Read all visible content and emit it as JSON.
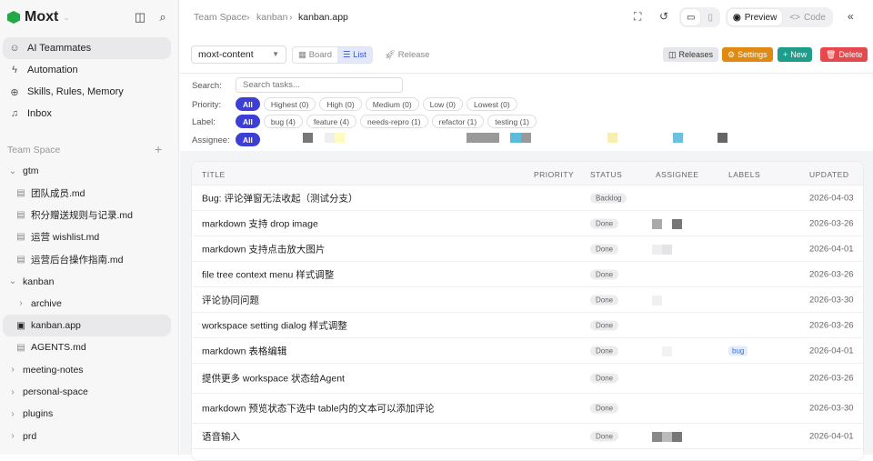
{
  "sidebar": {
    "brand": "Moxt",
    "nav": [
      {
        "label": "AI Teammates",
        "icon": "teammates-icon"
      },
      {
        "label": "Automation",
        "icon": "bolt-icon"
      },
      {
        "label": "Skills, Rules, Memory",
        "icon": "skills-icon"
      },
      {
        "label": "Inbox",
        "icon": "bell-icon"
      }
    ],
    "section": "Team Space",
    "tree": [
      {
        "label": "gtm",
        "type": "folder",
        "open": true,
        "depth": 0
      },
      {
        "label": "团队成员.md",
        "type": "file",
        "depth": 1
      },
      {
        "label": "积分赠送规则与记录.md",
        "type": "file",
        "depth": 1
      },
      {
        "label": "运营 wishlist.md",
        "type": "file",
        "depth": 1
      },
      {
        "label": "运营后台操作指南.md",
        "type": "file",
        "depth": 1
      },
      {
        "label": "kanban",
        "type": "folder",
        "open": true,
        "depth": 0
      },
      {
        "label": "archive",
        "type": "folder",
        "depth": 1
      },
      {
        "label": "kanban.app",
        "type": "app",
        "depth": 1,
        "active": true
      },
      {
        "label": "AGENTS.md",
        "type": "file",
        "depth": 1
      },
      {
        "label": "meeting-notes",
        "type": "folder",
        "depth": 0
      },
      {
        "label": "personal-space",
        "type": "folder",
        "depth": 0
      },
      {
        "label": "plugins",
        "type": "folder",
        "depth": 0
      },
      {
        "label": "prd",
        "type": "folder",
        "depth": 0
      }
    ]
  },
  "header": {
    "breadcrumb": [
      "Team Space",
      "kanban",
      "kanban.app"
    ],
    "preview": "Preview",
    "code": "Code"
  },
  "toolbar": {
    "project": "moxt-content",
    "board": "Board",
    "list": "List",
    "release": "Release",
    "releases": "Releases",
    "settings": "Settings",
    "new": "New",
    "delete": "Delete",
    "colors": {
      "settings": "#e08a12",
      "new": "#1e9e8a",
      "delete": "#e5484d"
    }
  },
  "filters": {
    "search_label": "Search:",
    "search_placeholder": "Search tasks...",
    "priority_label": "Priority:",
    "priority": [
      "All",
      "Highest (0)",
      "High (0)",
      "Medium (0)",
      "Low (0)",
      "Lowest (0)"
    ],
    "label_label": "Label:",
    "labels": [
      "All",
      "bug (4)",
      "feature (4)",
      "needs-repro (1)",
      "refactor (1)",
      "testing (1)"
    ],
    "assignee_label": "Assignee:",
    "assignee_all": "All"
  },
  "table": {
    "columns": [
      "TITLE",
      "PRIORITY",
      "STATUS",
      "ASSIGNEE",
      "LABELS",
      "UPDATED"
    ],
    "rows": [
      {
        "title": "Bug: 评论弹窗无法收起（测试分支）",
        "status": "Backlog",
        "label": "",
        "updated": "2026-04-03"
      },
      {
        "title": "markdown 支持 drop image",
        "status": "Done",
        "label": "",
        "updated": "2026-03-26"
      },
      {
        "title": "markdown 支持点击放大图片",
        "status": "Done",
        "label": "",
        "updated": "2026-04-01"
      },
      {
        "title": "file tree context menu 样式调整",
        "status": "Done",
        "label": "",
        "updated": "2026-03-26"
      },
      {
        "title": "评论协同问题",
        "status": "Done",
        "label": "",
        "updated": "2026-03-30"
      },
      {
        "title": "workspace setting dialog 样式调整",
        "status": "Done",
        "label": "",
        "updated": "2026-03-26"
      },
      {
        "title": "markdown 表格编辑",
        "status": "Done",
        "label": "bug",
        "updated": "2026-04-01"
      },
      {
        "title": "提供更多 workspace 状态给Agent",
        "status": "Done",
        "label": "",
        "updated": "2026-03-26"
      },
      {
        "title": "markdown 预览状态下选中 table内的文本可以添加评论",
        "status": "Done",
        "label": "",
        "updated": "2026-03-30"
      },
      {
        "title": "语音输入",
        "status": "Done",
        "label": "",
        "updated": "2026-04-01"
      }
    ]
  }
}
